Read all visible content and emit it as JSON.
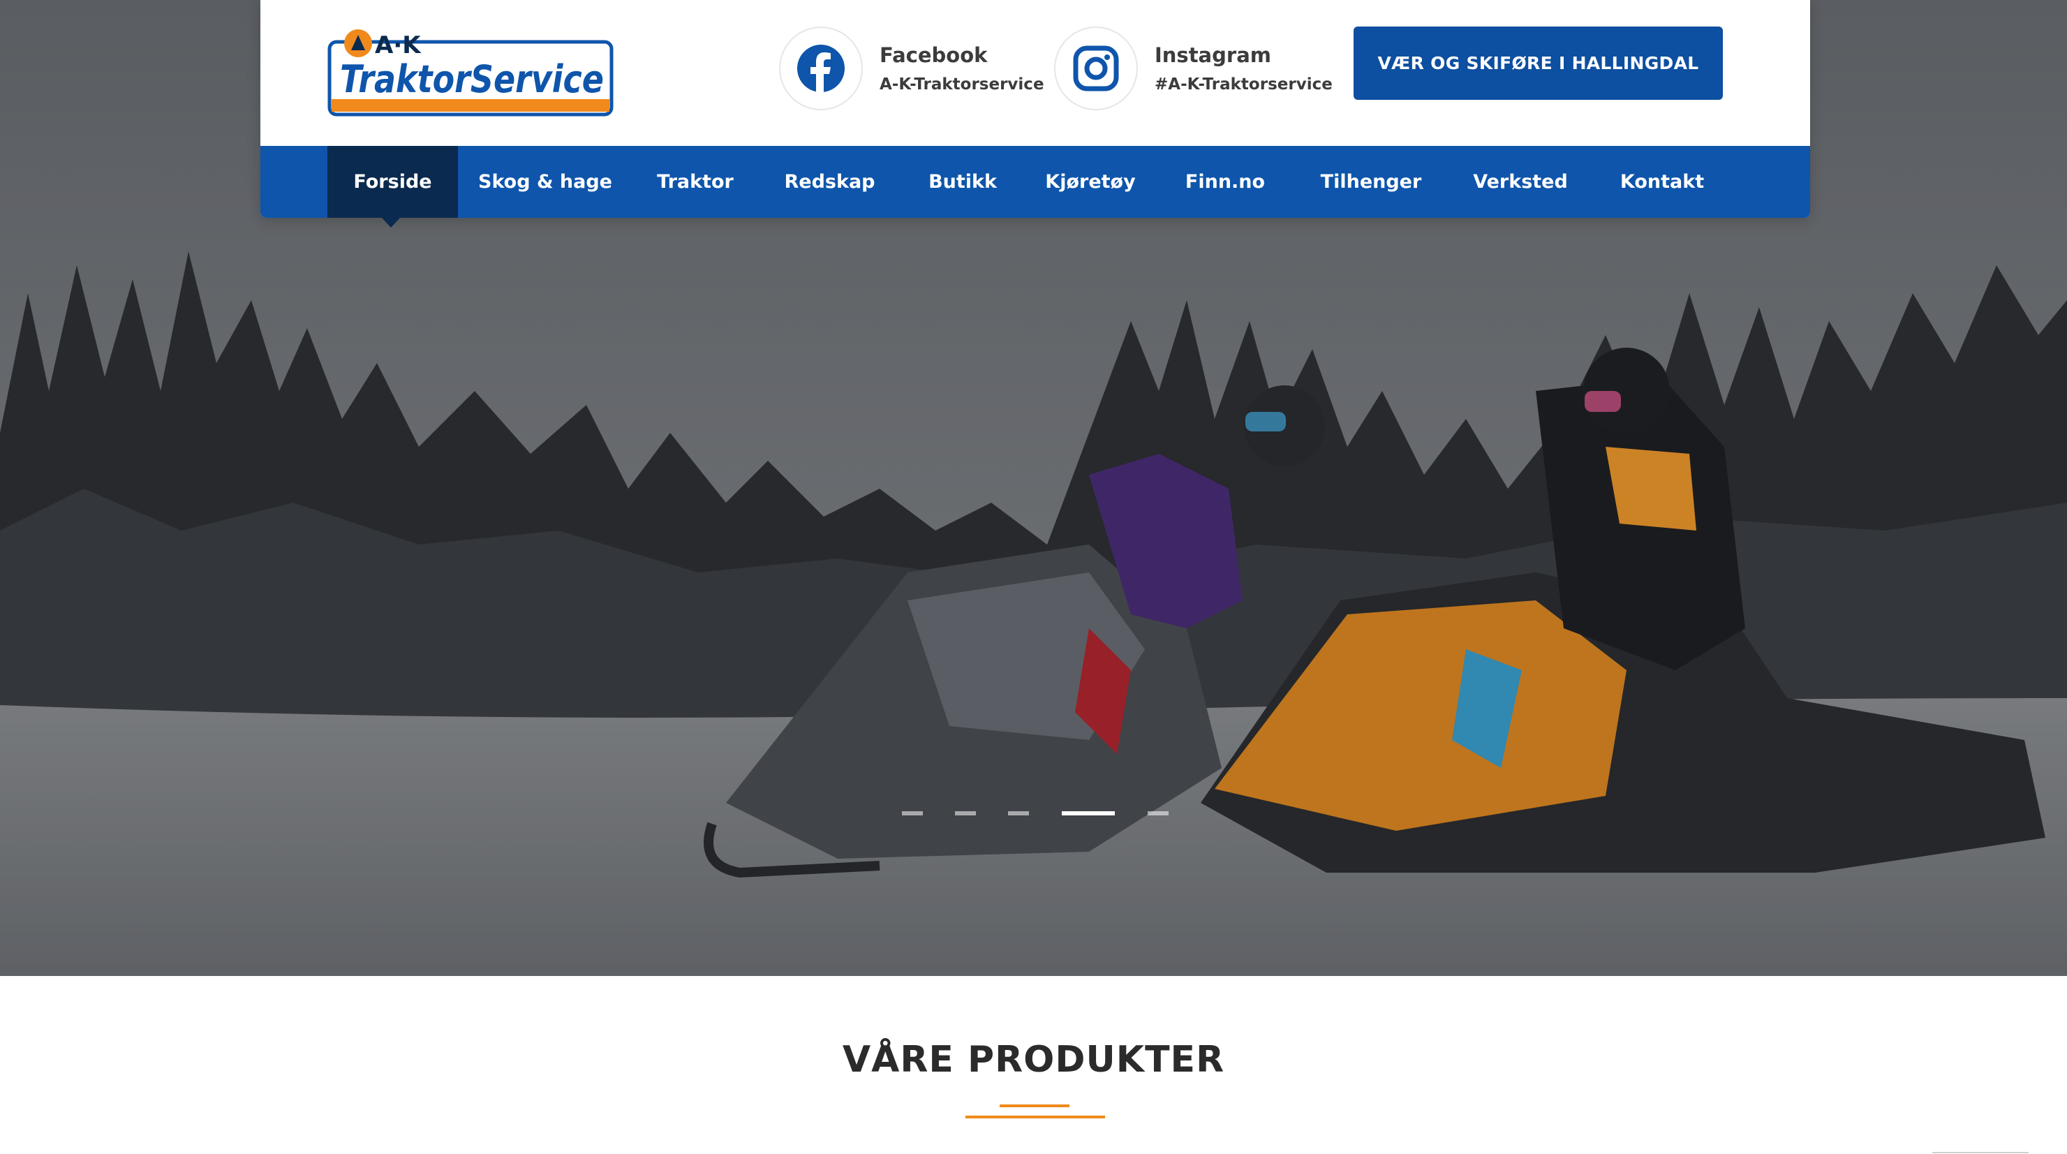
{
  "brand": {
    "logo_top": "A·K",
    "logo_main": "TraktorService",
    "colors": {
      "primary": "#0e55ab",
      "dark": "#0b2a4f",
      "accent": "#f08a1c"
    }
  },
  "social": {
    "facebook": {
      "title": "Facebook",
      "handle": "A-K-Traktorservice",
      "icon": "facebook-icon"
    },
    "instagram": {
      "title": "Instagram",
      "handle": "#A-K-Traktorservice",
      "icon": "instagram-icon"
    }
  },
  "cta": {
    "label": "VÆR OG SKIFØRE I HALLINGDAL"
  },
  "nav": {
    "items": [
      {
        "label": "Forside",
        "active": true
      },
      {
        "label": "Skog & hage"
      },
      {
        "label": "Traktor"
      },
      {
        "label": "Redskap"
      },
      {
        "label": "Butikk"
      },
      {
        "label": "Kjøretøy"
      },
      {
        "label": "Finn.no"
      },
      {
        "label": "Tilhenger"
      },
      {
        "label": "Verksted"
      },
      {
        "label": "Kontakt"
      }
    ]
  },
  "slider": {
    "count": 5,
    "active_index": 3
  },
  "section": {
    "title": "VÅRE PRODUKTER"
  }
}
